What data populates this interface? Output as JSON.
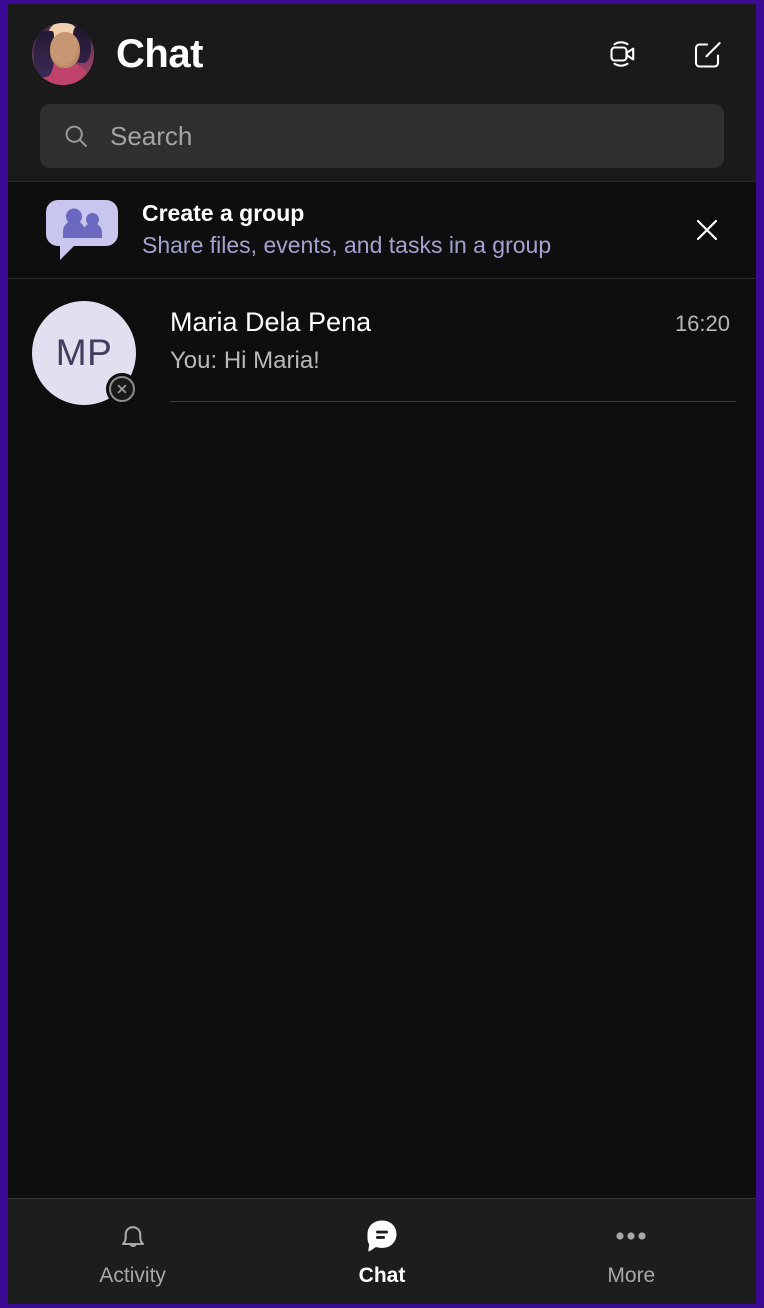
{
  "theme": {
    "frame_border": "#3a0a92",
    "header_bg": "#1a1a1a",
    "body_bg": "#0e0e0e",
    "search_bg": "#2f2f2f",
    "accent_lavender": "#a3a3cf",
    "avatar_bg": "#e1e0f0",
    "avatar_text": "#403d5e",
    "navbar_bg": "#1d1d1d"
  },
  "header": {
    "title": "Chat",
    "avatar": {
      "name": "user-avatar",
      "icon": "profile-photo"
    },
    "actions": [
      {
        "name": "meet-now-button",
        "icon": "video-camera-icon"
      },
      {
        "name": "new-chat-button",
        "icon": "compose-icon"
      }
    ]
  },
  "search": {
    "placeholder": "Search",
    "value": "",
    "icon": "search-icon"
  },
  "banner": {
    "icon": "group-people-bubble-icon",
    "title": "Create a group",
    "subtitle": "Share files, events, and tasks in a group",
    "close_icon": "close-icon"
  },
  "chats": [
    {
      "initials": "MP",
      "name": "Maria Dela Pena",
      "preview": "You: Hi Maria!",
      "time": "16:20",
      "presence": "offline-x-icon"
    }
  ],
  "bottom_nav": {
    "items": [
      {
        "label": "Activity",
        "icon": "bell-icon",
        "active": false
      },
      {
        "label": "Chat",
        "icon": "chat-bubble-filled-icon",
        "active": true
      },
      {
        "label": "More",
        "icon": "ellipsis-icon",
        "active": false
      }
    ]
  }
}
